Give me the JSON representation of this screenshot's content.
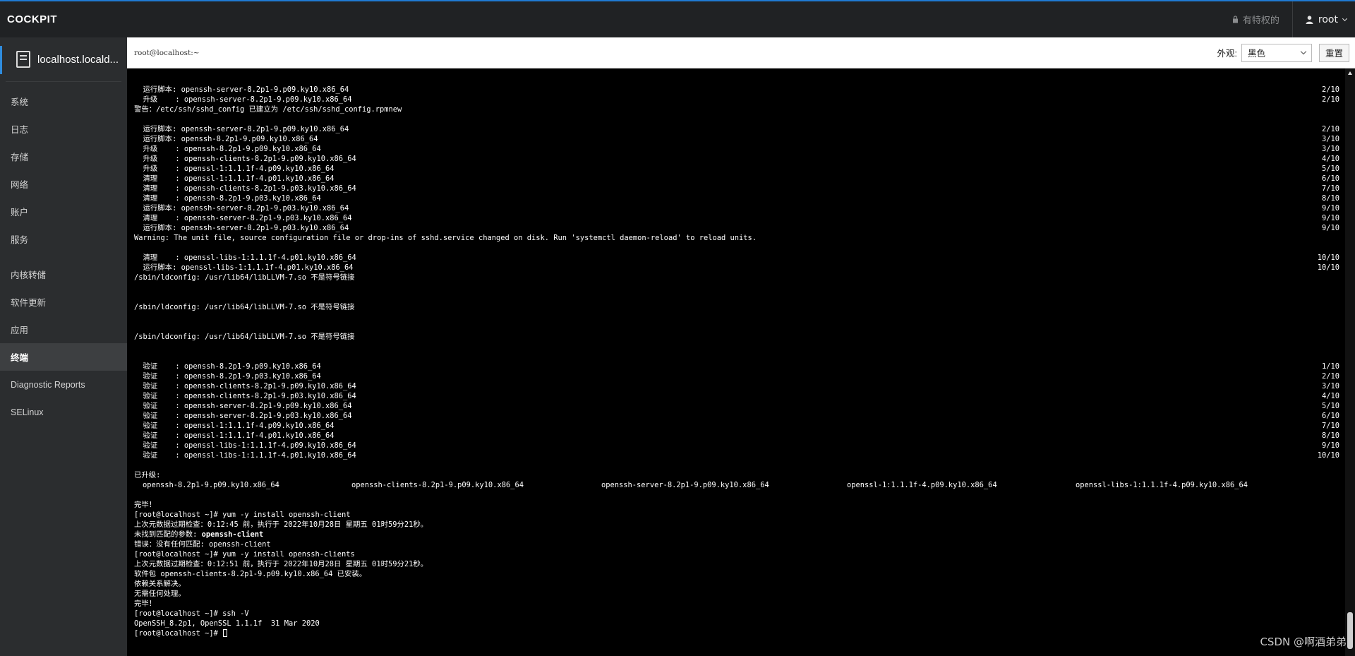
{
  "topbar": {
    "brand": "COCKPIT",
    "privileged": "有特权的",
    "user": "root"
  },
  "sidebar": {
    "host": "localhost.locald...",
    "group1": [
      "系统",
      "日志",
      "存储",
      "网络",
      "账户",
      "服务"
    ],
    "group2": [
      "内核转储",
      "软件更新",
      "应用",
      "终端",
      "Diagnostic Reports",
      "SELinux"
    ],
    "active": "终端"
  },
  "terminal_header": {
    "title": "root@localhost:~",
    "appearance_label": "外观:",
    "theme_value": "黑色",
    "reset_label": "重置"
  },
  "terminal_lines": [
    {
      "t": "  运行脚本: openssh-server-8.2p1-9.p09.ky10.x86_64",
      "p": "2/10"
    },
    {
      "t": "  升级    : openssh-server-8.2p1-9.p09.ky10.x86_64",
      "p": "2/10"
    },
    {
      "t": "警告：/etc/ssh/sshd_config 已建立为 /etc/ssh/sshd_config.rpmnew",
      "p": ""
    },
    {
      "t": "",
      "p": ""
    },
    {
      "t": "  运行脚本: openssh-server-8.2p1-9.p09.ky10.x86_64",
      "p": "2/10"
    },
    {
      "t": "  运行脚本: openssh-8.2p1-9.p09.ky10.x86_64",
      "p": "3/10"
    },
    {
      "t": "  升级    : openssh-8.2p1-9.p09.ky10.x86_64",
      "p": "3/10"
    },
    {
      "t": "  升级    : openssh-clients-8.2p1-9.p09.ky10.x86_64",
      "p": "4/10"
    },
    {
      "t": "  升级    : openssl-1:1.1.1f-4.p09.ky10.x86_64",
      "p": "5/10"
    },
    {
      "t": "  清理    : openssl-1:1.1.1f-4.p01.ky10.x86_64",
      "p": "6/10"
    },
    {
      "t": "  清理    : openssh-clients-8.2p1-9.p03.ky10.x86_64",
      "p": "7/10"
    },
    {
      "t": "  清理    : openssh-8.2p1-9.p03.ky10.x86_64",
      "p": "8/10"
    },
    {
      "t": "  运行脚本: openssh-server-8.2p1-9.p03.ky10.x86_64",
      "p": "9/10"
    },
    {
      "t": "  清理    : openssh-server-8.2p1-9.p03.ky10.x86_64",
      "p": "9/10"
    },
    {
      "t": "  运行脚本: openssh-server-8.2p1-9.p03.ky10.x86_64",
      "p": "9/10"
    },
    {
      "t": "Warning: The unit file, source configuration file or drop-ins of sshd.service changed on disk. Run 'systemctl daemon-reload' to reload units.",
      "p": ""
    },
    {
      "t": "",
      "p": ""
    },
    {
      "t": "  清理    : openssl-libs-1:1.1.1f-4.p01.ky10.x86_64",
      "p": "10/10"
    },
    {
      "t": "  运行脚本: openssl-libs-1:1.1.1f-4.p01.ky10.x86_64",
      "p": "10/10"
    },
    {
      "t": "/sbin/ldconfig: /usr/lib64/libLLVM-7.so 不是符号链接",
      "p": ""
    },
    {
      "t": "",
      "p": ""
    },
    {
      "t": "",
      "p": ""
    },
    {
      "t": "/sbin/ldconfig: /usr/lib64/libLLVM-7.so 不是符号链接",
      "p": ""
    },
    {
      "t": "",
      "p": ""
    },
    {
      "t": "",
      "p": ""
    },
    {
      "t": "/sbin/ldconfig: /usr/lib64/libLLVM-7.so 不是符号链接",
      "p": ""
    },
    {
      "t": "",
      "p": ""
    },
    {
      "t": "",
      "p": ""
    },
    {
      "t": "  验证    : openssh-8.2p1-9.p09.ky10.x86_64",
      "p": "1/10"
    },
    {
      "t": "  验证    : openssh-8.2p1-9.p03.ky10.x86_64",
      "p": "2/10"
    },
    {
      "t": "  验证    : openssh-clients-8.2p1-9.p09.ky10.x86_64",
      "p": "3/10"
    },
    {
      "t": "  验证    : openssh-clients-8.2p1-9.p03.ky10.x86_64",
      "p": "4/10"
    },
    {
      "t": "  验证    : openssh-server-8.2p1-9.p09.ky10.x86_64",
      "p": "5/10"
    },
    {
      "t": "  验证    : openssh-server-8.2p1-9.p03.ky10.x86_64",
      "p": "6/10"
    },
    {
      "t": "  验证    : openssl-1:1.1.1f-4.p09.ky10.x86_64",
      "p": "7/10"
    },
    {
      "t": "  验证    : openssl-1:1.1.1f-4.p01.ky10.x86_64",
      "p": "8/10"
    },
    {
      "t": "  验证    : openssl-libs-1:1.1.1f-4.p09.ky10.x86_64",
      "p": "9/10"
    },
    {
      "t": "  验证    : openssl-libs-1:1.1.1f-4.p01.ky10.x86_64",
      "p": "10/10"
    },
    {
      "t": "",
      "p": ""
    },
    {
      "t": "已升级:",
      "p": ""
    }
  ],
  "upgraded_packages": [
    "openssh-8.2p1-9.p09.ky10.x86_64",
    "openssh-clients-8.2p1-9.p09.ky10.x86_64",
    "openssh-server-8.2p1-9.p09.ky10.x86_64",
    "openssl-1:1.1.1f-4.p09.ky10.x86_64",
    "openssl-libs-1:1.1.1f-4.p09.ky10.x86_64"
  ],
  "terminal_tail": [
    {
      "t": "",
      "b": ""
    },
    {
      "t": "完毕！",
      "b": ""
    },
    {
      "t": "[root@localhost ~]# yum -y install openssh-client",
      "b": ""
    },
    {
      "t": "上次元数据过期检查：0:12:45 前，执行于 2022年10月28日 星期五 01时59分21秒。",
      "b": ""
    },
    {
      "t": "未找到匹配的参数: ",
      "b": "openssh-client"
    },
    {
      "t": "错误：没有任何匹配: openssh-client",
      "b": ""
    },
    {
      "t": "[root@localhost ~]# yum -y install openssh-clients",
      "b": ""
    },
    {
      "t": "上次元数据过期检查：0:12:51 前，执行于 2022年10月28日 星期五 01时59分21秒。",
      "b": ""
    },
    {
      "t": "软件包 openssh-clients-8.2p1-9.p09.ky10.x86_64 已安装。",
      "b": ""
    },
    {
      "t": "依赖关系解决。",
      "b": ""
    },
    {
      "t": "无需任何处理。",
      "b": ""
    },
    {
      "t": "完毕！",
      "b": ""
    },
    {
      "t": "[root@localhost ~]# ssh -V",
      "b": ""
    },
    {
      "t": "OpenSSH_8.2p1, OpenSSL 1.1.1f  31 Mar 2020",
      "b": ""
    }
  ],
  "prompt": "[root@localhost ~]# ",
  "watermark": "CSDN @啊酒弟弟"
}
